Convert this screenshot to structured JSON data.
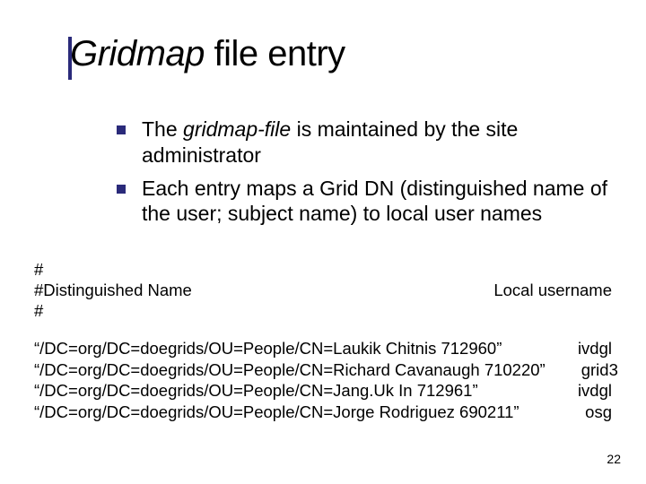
{
  "title": {
    "part_italic": "Gridmap",
    "part_plain": " file entry"
  },
  "bullets": [
    {
      "pre": "The ",
      "italic": "gridmap-file",
      "post": " is maintained by the site administrator"
    },
    {
      "pre": "Each entry maps a Grid DN (distinguished name of the user; subject name) to local user names",
      "italic": "",
      "post": ""
    }
  ],
  "comment": {
    "line1": "#",
    "line2_left": "#Distinguished Name",
    "line2_right": "Local username",
    "line3": "#"
  },
  "entries": [
    {
      "dn": "“/DC=org/DC=doegrids/OU=People/CN=Laukik Chitnis 712960”",
      "user": "ivdgl"
    },
    {
      "dn": "“/DC=org/DC=doegrids/OU=People/CN=Richard Cavanaugh 710220”",
      "user": "grid3"
    },
    {
      "dn": "“/DC=org/DC=doegrids/OU=People/CN=Jang.Uk In  712961”",
      "user": "ivdgl"
    },
    {
      "dn": "“/DC=org/DC=doegrids/OU=People/CN=Jorge Rodriguez 690211”",
      "user": "osg"
    }
  ],
  "page_number": "22"
}
